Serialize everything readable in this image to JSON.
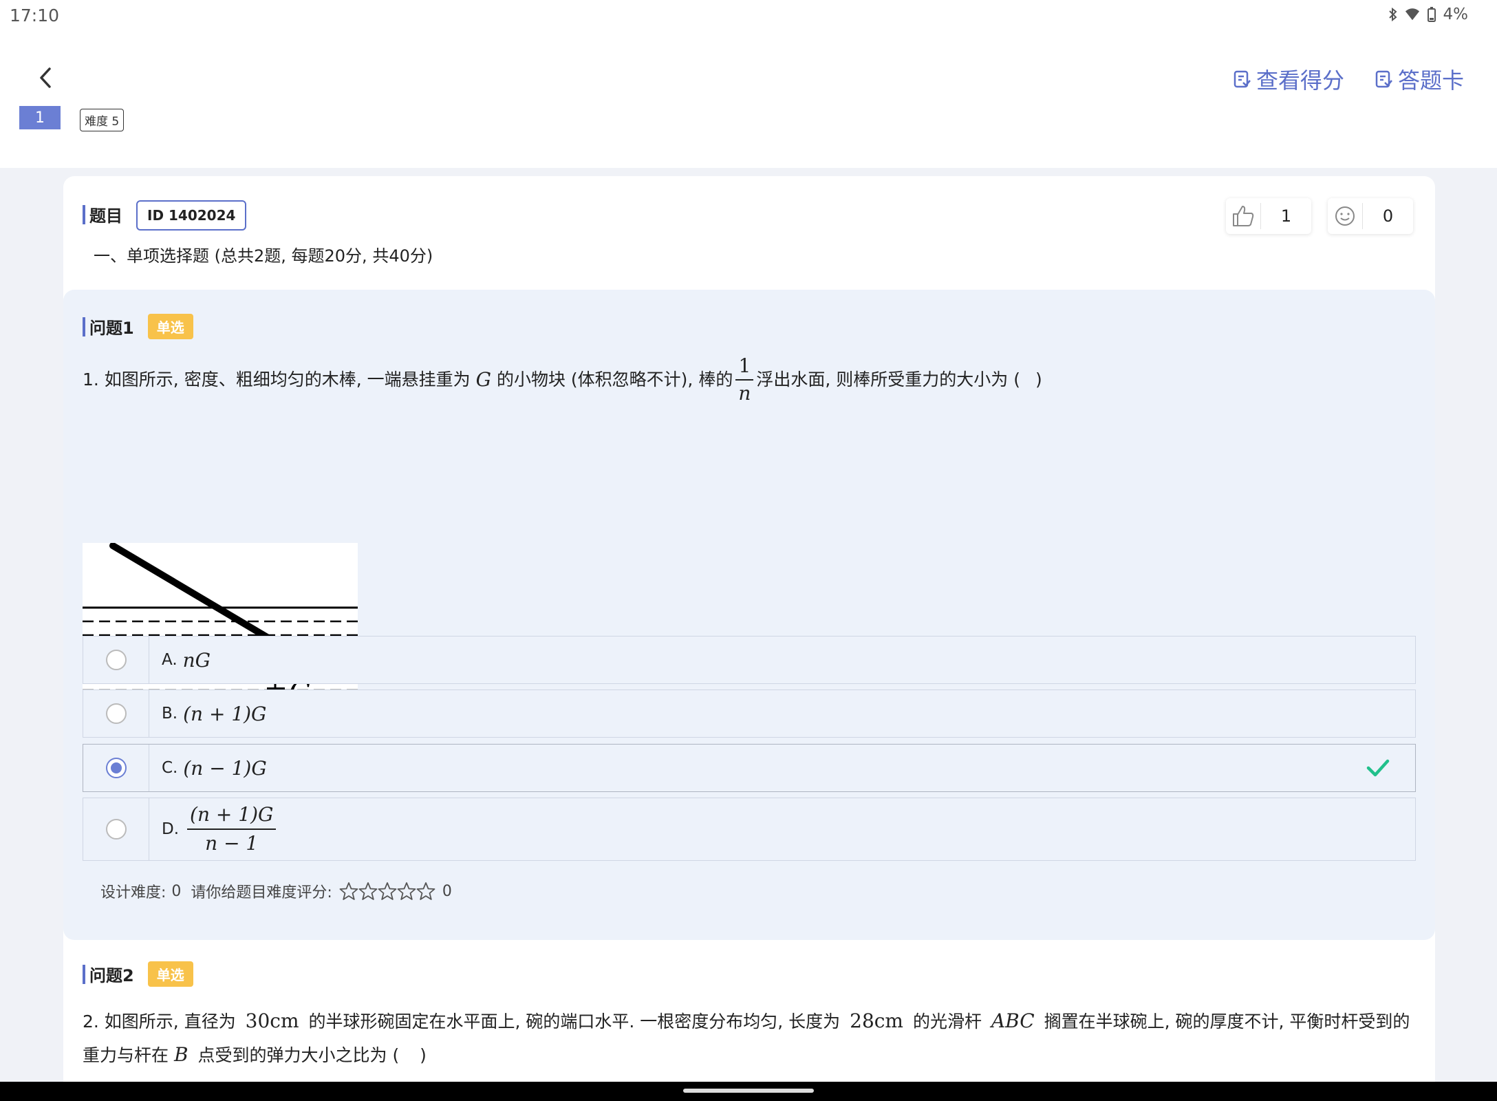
{
  "status": {
    "time": "17:10",
    "battery": "4%"
  },
  "topbar": {
    "view_score": "查看得分",
    "answer_card": "答题卡",
    "question_tab": "1",
    "difficulty_badge": "难度 5"
  },
  "header": {
    "section_title": "题目",
    "id_badge": "ID 1402024",
    "section_desc": "一、单项选择题 (总共2题, 每题20分, 共40分)",
    "likes": "1",
    "emoji_count": "0"
  },
  "question1": {
    "title": "问题1",
    "tag": "单选",
    "text_a": "1. 如图所示, 密度、粗细均匀的木棒, 一端悬挂重为",
    "var_g": "G",
    "text_b": "的小物块 (体积忽略不计), 棒的",
    "frac_num": "1",
    "frac_den": "n",
    "text_c": "浮出水面, 则棒所受重力的大小为 (",
    "text_d": ")",
    "figure_label": "G",
    "options": [
      {
        "label": "A.",
        "math": "nG"
      },
      {
        "label": "B.",
        "math": "(n + 1)G"
      },
      {
        "label": "C.",
        "math": "(n − 1)G",
        "selected": true,
        "correct": true
      },
      {
        "label": "D.",
        "num": "(n + 1)G",
        "den": "n − 1"
      }
    ],
    "rating": {
      "design_label": "设计难度:",
      "design_value": "0",
      "rate_label": "请你给题目难度评分:",
      "score": "0",
      "stars": 0
    }
  },
  "question2": {
    "title": "问题2",
    "tag": "单选",
    "text_a": "2. 如图所示, 直径为",
    "v1": "30cm",
    "text_b": "的半球形碗固定在水平面上, 碗的端口水平. 一根密度分布均匀, 长度为",
    "v2": "28cm",
    "text_c": "的光滑杆",
    "v3": "ABC",
    "text_d": "搁置在半球碗上, 碗的厚度不计, 平衡时杆受到的重力与杆在",
    "v4": "B",
    "text_e": "点受到的弹力大小之比为 (",
    "text_f": ")"
  },
  "colors": {
    "accent": "#5b6fc9",
    "tag": "#f8c24a",
    "correct": "#21c08b",
    "block_bg": "#edf2fa"
  }
}
